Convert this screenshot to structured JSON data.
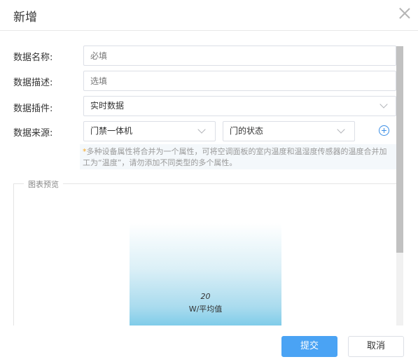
{
  "dialog": {
    "title": "新增",
    "close_icon": "close-icon"
  },
  "form": {
    "name": {
      "label": "数据名称:",
      "placeholder": "必填",
      "value": ""
    },
    "desc": {
      "label": "数据描述:",
      "placeholder": "选填",
      "value": ""
    },
    "plugin": {
      "label": "数据插件:",
      "value": "实时数据",
      "icon": "chevron-down-icon"
    },
    "source": {
      "label": "数据来源:",
      "device": "门禁一体机",
      "attribute": "门的状态",
      "add_icon": "plus-circle-icon"
    },
    "hint": {
      "star": "*",
      "text": "多种设备属性将合并为一个属性，可将空调面板的室内温度和温湿度传感器的温度合并加工为“温度”，请勿添加不同类型的多个属性。"
    }
  },
  "preview": {
    "legend": "图表预览"
  },
  "chart_data": {
    "type": "bar",
    "categories": [
      "W/平均值"
    ],
    "values": [
      20
    ],
    "title": "",
    "xlabel": "",
    "ylabel": "",
    "data_labels": [
      "20"
    ],
    "bar_colors": [
      "#ffffff",
      "#6ac4e6"
    ]
  },
  "footer": {
    "submit": "提交",
    "cancel": "取消"
  },
  "colors": {
    "primary": "#4aa3f4",
    "accent_star": "#f5a623",
    "border": "#dcdfe6"
  }
}
